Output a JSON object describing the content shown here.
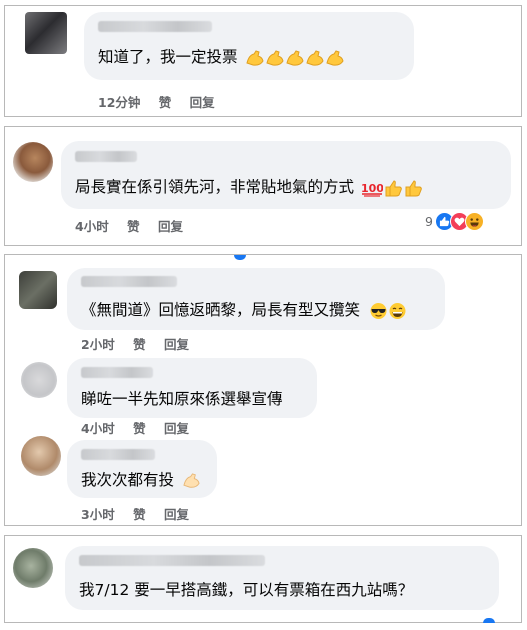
{
  "comments": [
    {
      "text": "知道了，我一定投票",
      "emojis": [
        "flexed-biceps",
        "flexed-biceps",
        "flexed-biceps",
        "flexed-biceps",
        "flexed-biceps"
      ],
      "time": "12分钟",
      "like": "赞",
      "reply": "回复"
    },
    {
      "text": "局長實在係引領先河，非常貼地氣的方式",
      "emojis": [
        "hundred-points",
        "thumbs-up",
        "thumbs-up"
      ],
      "time": "4小时",
      "like": "赞",
      "reply": "回复",
      "reaction_count": "9",
      "reactions": [
        "like-reaction",
        "love-reaction",
        "haha-reaction"
      ]
    },
    {
      "text": "《無間道》回憶返晒黎，局長有型又攬笑",
      "emojis": [
        "sunglasses-face",
        "grinning-face"
      ],
      "time": "2小时",
      "like": "赞",
      "reply": "回复"
    },
    {
      "text": "睇咗一半先知原來係選舉宣傳",
      "emojis": [],
      "time": "4小时",
      "like": "赞",
      "reply": "回复"
    },
    {
      "text": "我次次都有投",
      "emojis": [
        "flexed-biceps"
      ],
      "time": "3小时",
      "like": "赞",
      "reply": "回复"
    },
    {
      "text": "我7/12 要一早搭高鐵，可以有票箱在西九站嗎？",
      "emojis": []
    }
  ],
  "colors": {
    "bubble": "#f0f2f5",
    "meta_text": "#65676b",
    "like_blue": "#1877f2",
    "love_red": "#f33e58",
    "haha_yellow": "#f7b125",
    "emoji_yellow": "#ffcc33"
  }
}
